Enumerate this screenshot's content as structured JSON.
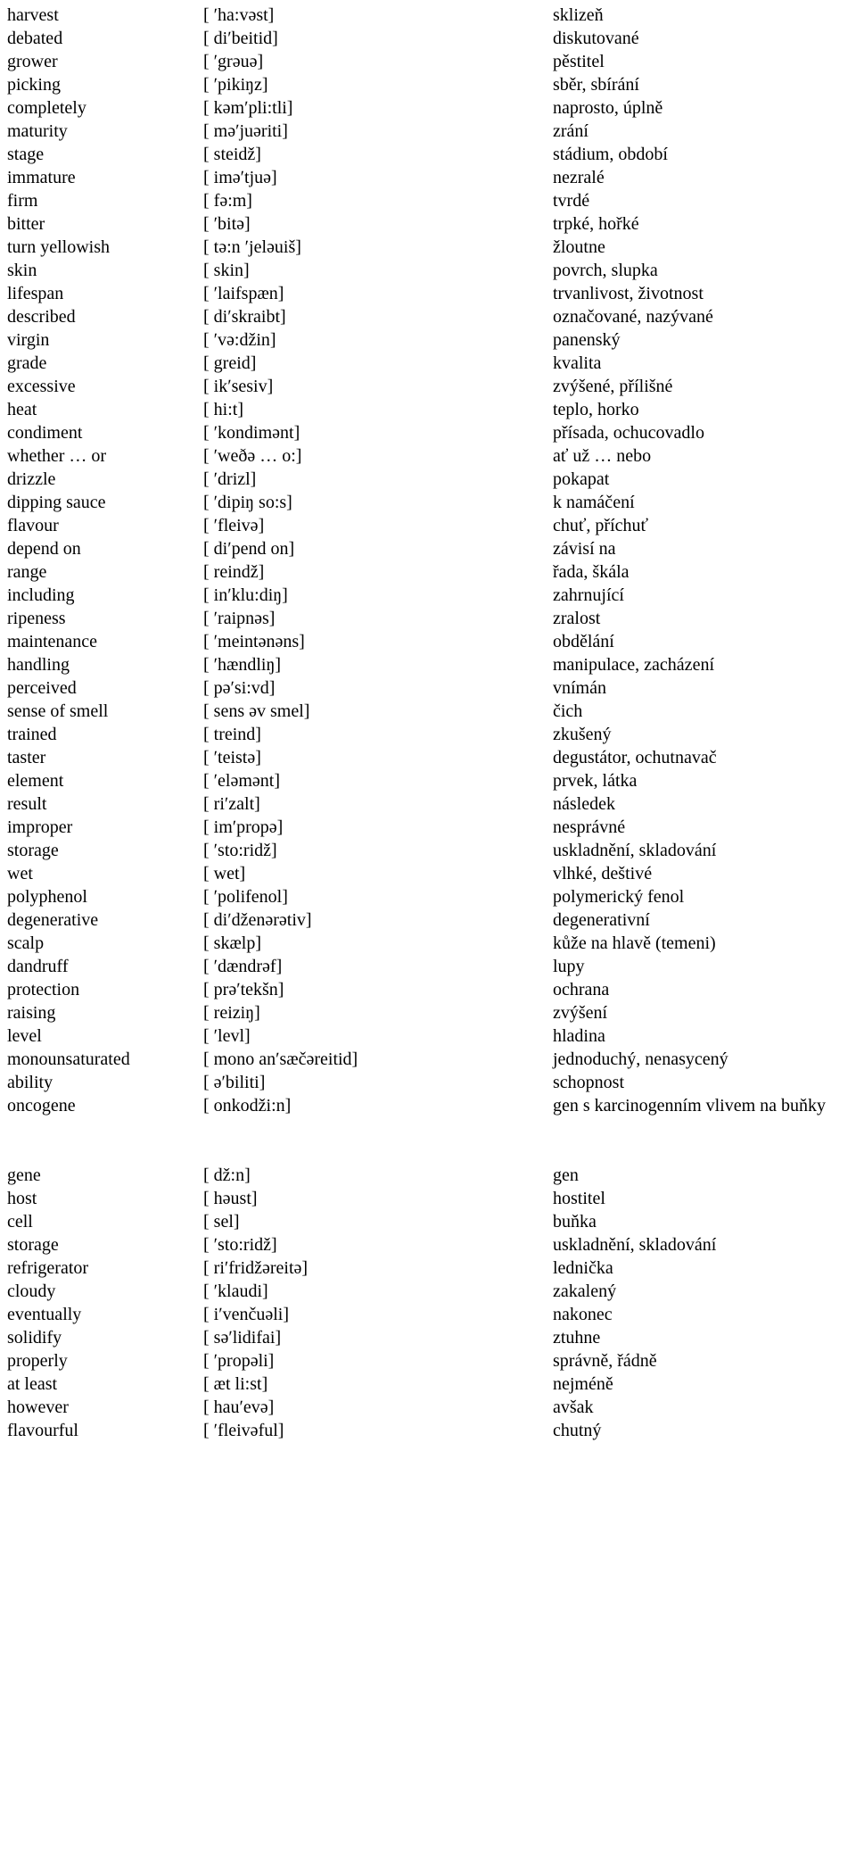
{
  "document": {
    "kind": "vocabulary-glossary",
    "columns": {
      "word": "English word",
      "phonetic": "Phonetic transcription",
      "translation": "Czech translation"
    }
  },
  "entries": [
    {
      "word": "harvest",
      "phonetic": "[ ʹha:vəst]",
      "translation": "sklizeň"
    },
    {
      "word": "debated",
      "phonetic": "[ diʹbeitid]",
      "translation": "diskutované"
    },
    {
      "word": "grower",
      "phonetic": "[ ʹgrəuə]",
      "translation": "pěstitel"
    },
    {
      "word": "picking",
      "phonetic": "[ ʹpikiŋz]",
      "translation": "sběr, sbírání"
    },
    {
      "word": "completely",
      "phonetic": "[ kəmʹpli:tli]",
      "translation": "naprosto, úplně"
    },
    {
      "word": "maturity",
      "phonetic": "[ məʹjuəriti]",
      "translation": "zrání"
    },
    {
      "word": "stage",
      "phonetic": "[ steidž]",
      "translation": "stádium, období"
    },
    {
      "word": "immature",
      "phonetic": "[ iməʹtjuə]",
      "translation": "nezralé"
    },
    {
      "word": "firm",
      "phonetic": "[ fə:m]",
      "translation": "tvrdé"
    },
    {
      "word": "bitter",
      "phonetic": "[ ʹbitə]",
      "translation": "trpké, hořké"
    },
    {
      "word": "turn yellowish",
      "phonetic": "[ tə:n ʹjeləuiš]",
      "translation": "žloutne"
    },
    {
      "word": "skin",
      "phonetic": "[ skin]",
      "translation": "povrch, slupka"
    },
    {
      "word": "lifespan",
      "phonetic": "[ ʹlaifspæn]",
      "translation": "trvanlivost, životnost"
    },
    {
      "word": "described",
      "phonetic": "[ diʹskraibt]",
      "translation": "označované, nazývané"
    },
    {
      "word": "virgin",
      "phonetic": "[ ʹvə:džin]",
      "translation": "panenský"
    },
    {
      "word": "grade",
      "phonetic": "[ greid]",
      "translation": "kvalita"
    },
    {
      "word": "excessive",
      "phonetic": "[ ikʹsesiv]",
      "translation": "zvýšené, přílišné"
    },
    {
      "word": "heat",
      "phonetic": "[ hi:t]",
      "translation": "teplo, horko"
    },
    {
      "word": "condiment",
      "phonetic": "[ ʹkondimənt]",
      "translation": "přísada, ochucovadlo"
    },
    {
      "word": "whether … or",
      "phonetic": "[ ʹweðə … o:]",
      "translation": "ať už … nebo"
    },
    {
      "word": "drizzle",
      "phonetic": "[ ʹdrizl]",
      "translation": "pokapat"
    },
    {
      "word": "dipping sauce",
      "phonetic": "[ ʹdipiŋ so:s]",
      "translation": "k namáčení"
    },
    {
      "word": "flavour",
      "phonetic": "[ ʹfleivə]",
      "translation": "chuť, příchuť"
    },
    {
      "word": "depend on",
      "phonetic": "[ diʹpend on]",
      "translation": "závisí na"
    },
    {
      "word": "range",
      "phonetic": "[ reindž]",
      "translation": "řada, škála"
    },
    {
      "word": "including",
      "phonetic": "[ inʹklu:diŋ]",
      "translation": "zahrnující"
    },
    {
      "word": "ripeness",
      "phonetic": "[ ʹraipnəs]",
      "translation": "zralost"
    },
    {
      "word": "maintenance",
      "phonetic": "[ ʹmeintənəns]",
      "translation": "obdělání"
    },
    {
      "word": "handling",
      "phonetic": "[ ʹhændliŋ]",
      "translation": "manipulace, zacházení"
    },
    {
      "word": "perceived",
      "phonetic": "[ pəʹsi:vd]",
      "translation": "vnímán"
    },
    {
      "word": "sense of smell",
      "phonetic": "[ sens əv smel]",
      "translation": "čich"
    },
    {
      "word": "trained",
      "phonetic": "[ treind]",
      "translation": "zkušený"
    },
    {
      "word": "taster",
      "phonetic": "[ ʹteistə]",
      "translation": "degustátor, ochutnavač"
    },
    {
      "word": "element",
      "phonetic": "[ ʹeləmənt]",
      "translation": "prvek, látka"
    },
    {
      "word": "result",
      "phonetic": "[ riʹzalt]",
      "translation": "následek"
    },
    {
      "word": "improper",
      "phonetic": "[ imʹpropə]",
      "translation": "nesprávné"
    },
    {
      "word": "storage",
      "phonetic": "[ ʹsto:ridž]",
      "translation": "uskladnění, skladování"
    },
    {
      "word": "wet",
      "phonetic": "[ wet]",
      "translation": "vlhké, deštivé"
    },
    {
      "word": "polyphenol",
      "phonetic": "[ ʹpolifenol]",
      "translation": "polymerický fenol"
    },
    {
      "word": "degenerative",
      "phonetic": "[ diʹdženərətiv]",
      "translation": "degenerativní"
    },
    {
      "word": "scalp",
      "phonetic": "[ skælp]",
      "translation": "kůže na hlavě (temeni)"
    },
    {
      "word": "dandruff",
      "phonetic": "[ ʹdændrəf]",
      "translation": "lupy"
    },
    {
      "word": "protection",
      "phonetic": "[ prəʹtekšn]",
      "translation": "ochrana"
    },
    {
      "word": "raising",
      "phonetic": "[ reiziŋ]",
      "translation": "zvýšení"
    },
    {
      "word": "level",
      "phonetic": "[ ʹlevl]",
      "translation": "hladina"
    },
    {
      "word": "monounsaturated",
      "phonetic": "[ mono anʹsæčəreitid]",
      "translation": "jednoduchý, nenasycený"
    },
    {
      "word": "ability",
      "phonetic": "[ əʹbiliti]",
      "translation": "schopnost"
    },
    {
      "word": "oncogene",
      "phonetic": "[ onkodži:n]",
      "translation": "gen s karcinogenním vlivem na buňky",
      "tall": true
    },
    {
      "spacer": true
    },
    {
      "word": "gene",
      "phonetic": "[ dž:n]",
      "translation": "gen"
    },
    {
      "word": "host",
      "phonetic": "[ həust]",
      "translation": "hostitel"
    },
    {
      "word": "cell",
      "phonetic": "[ sel]",
      "translation": "buňka"
    },
    {
      "word": "storage",
      "phonetic": "[ ʹsto:ridž]",
      "translation": "uskladnění, skladování"
    },
    {
      "word": "refrigerator",
      "phonetic": "[ riʹfridžəreitə]",
      "translation": "lednička"
    },
    {
      "word": "cloudy",
      "phonetic": "[ ʹklaudi]",
      "translation": "zakalený"
    },
    {
      "word": "eventually",
      "phonetic": "[ iʹvenčuəli]",
      "translation": "nakonec"
    },
    {
      "word": "solidify",
      "phonetic": "[ səʹlidifai]",
      "translation": "ztuhne"
    },
    {
      "word": "properly",
      "phonetic": "[ ʹpropəli]",
      "translation": "správně, řádně"
    },
    {
      "word": "at least",
      "phonetic": "[ æt li:st]",
      "translation": "nejméně"
    },
    {
      "word": "however",
      "phonetic": "[ hauʹevə]",
      "translation": "avšak"
    },
    {
      "word": "flavourful",
      "phonetic": "[ ʹfleivəful]",
      "translation": "chutný"
    }
  ]
}
